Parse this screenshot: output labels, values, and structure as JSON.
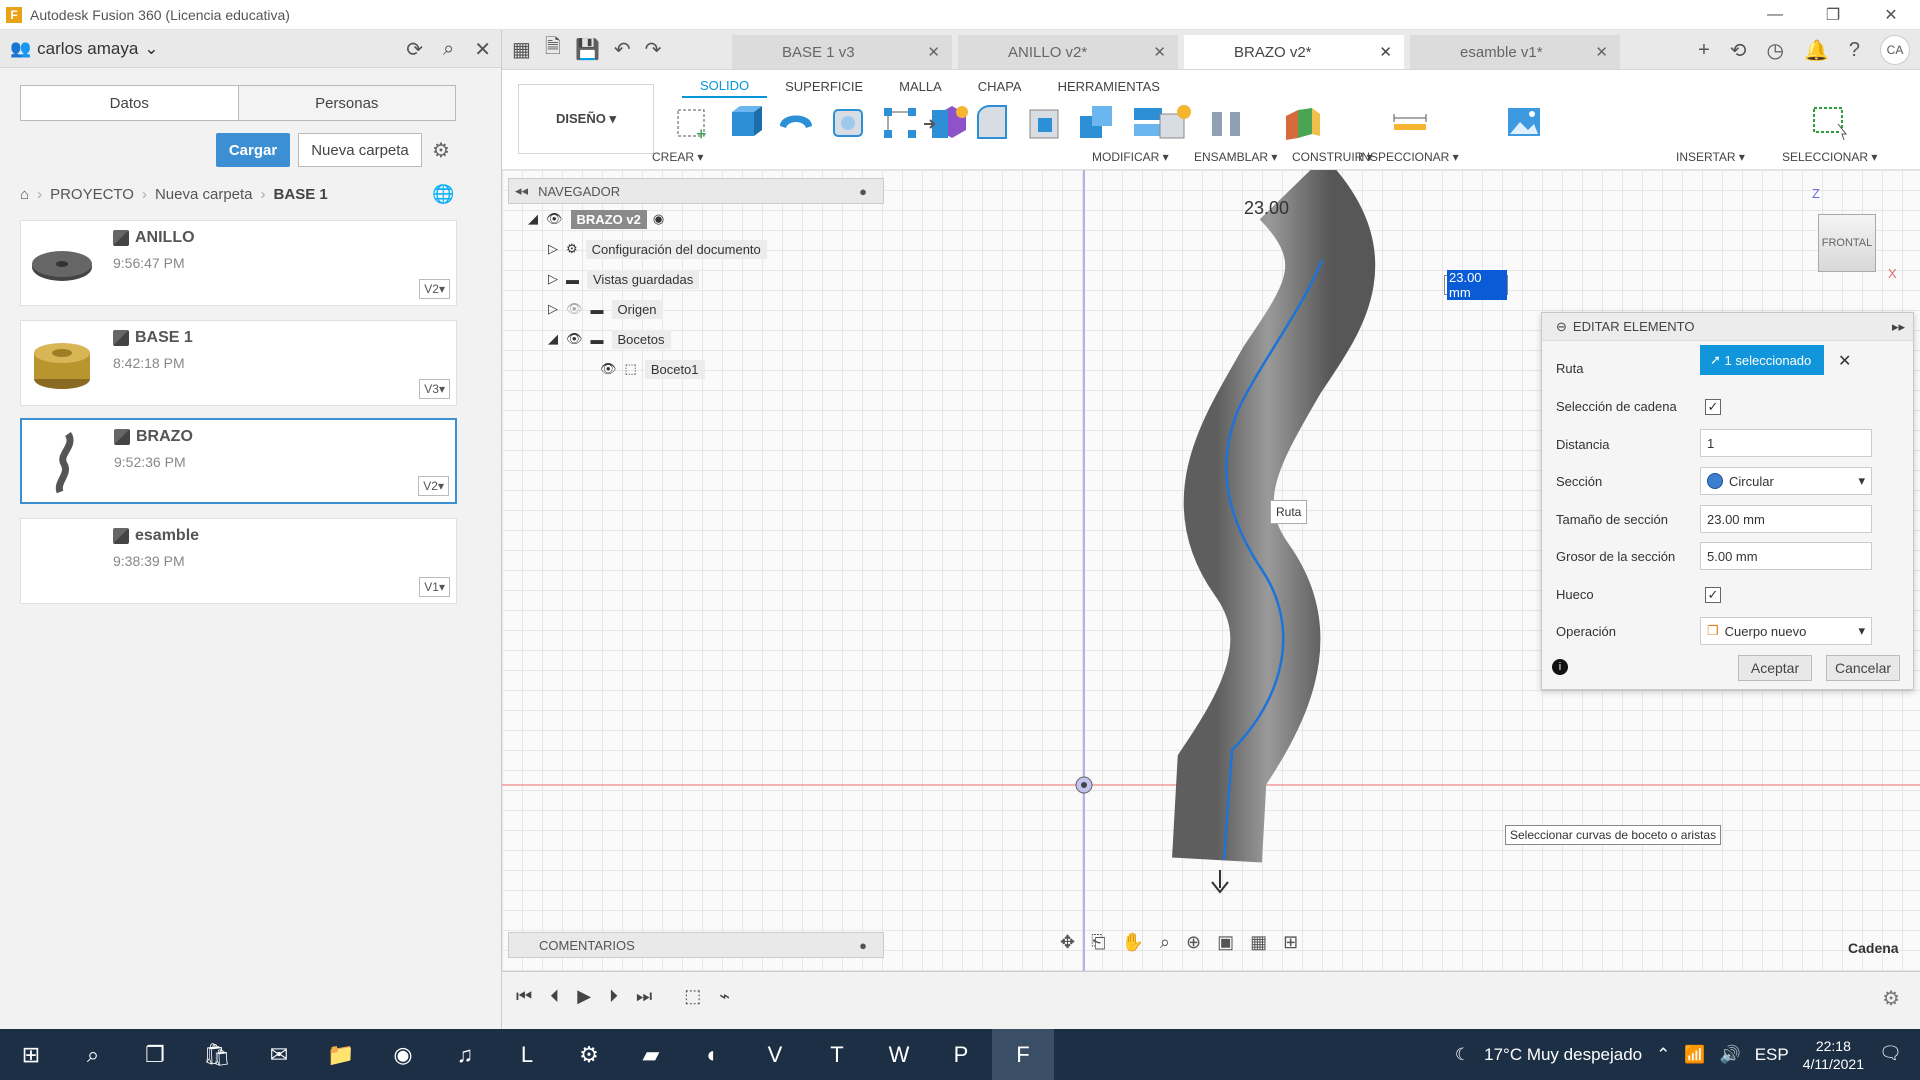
{
  "window": {
    "title": "Autodesk Fusion 360 (Licencia educativa)"
  },
  "data_panel": {
    "user": "carlos amaya",
    "tabs": [
      "Datos",
      "Personas"
    ],
    "upload_label": "Cargar",
    "new_folder_label": "Nueva carpeta",
    "breadcrumb": [
      "PROYECTO",
      "Nueva carpeta",
      "BASE 1"
    ],
    "files": [
      {
        "name": "ANILLO",
        "time": "9:56:47 PM",
        "version": "V2▾"
      },
      {
        "name": "BASE 1",
        "time": "8:42:18 PM",
        "version": "V3▾"
      },
      {
        "name": "BRAZO",
        "time": "9:52:36 PM",
        "version": "V2▾"
      },
      {
        "name": "esamble",
        "time": "9:38:39 PM",
        "version": "V1▾"
      }
    ]
  },
  "doc_tabs": [
    {
      "label": "BASE 1 v3"
    },
    {
      "label": "ANILLO v2*"
    },
    {
      "label": "BRAZO v2*"
    },
    {
      "label": "esamble v1*"
    }
  ],
  "user_initials": "CA",
  "ribbon": {
    "workspace": "DISEÑO ▾",
    "tabs": [
      "SOLIDO",
      "SUPERFICIE",
      "MALLA",
      "CHAPA",
      "HERRAMIENTAS"
    ],
    "groups": [
      "CREAR ▾",
      "MODIFICAR ▾",
      "ENSAMBLAR ▾",
      "CONSTRUIR ▾",
      "INSPECCIONAR ▾",
      "INSERTAR ▾",
      "SELECCIONAR ▾"
    ]
  },
  "navigator": {
    "title": "NAVEGADOR",
    "root": "BRAZO v2",
    "items": [
      "Configuración del documento",
      "Vistas guardadas",
      "Origen",
      "Bocetos",
      "Boceto1"
    ]
  },
  "comments": {
    "title": "COMENTARIOS"
  },
  "viewport": {
    "dimension_label": "23.00",
    "dimension_input": "23.00 mm",
    "ruta_tip": "Ruta",
    "tooltip": "Seleccionar curvas de boceto o aristas",
    "viewcube_label": "FRONTAL",
    "axis_z": "Z",
    "axis_x": "X",
    "status": "Cadena"
  },
  "dialog": {
    "title": "EDITAR ELEMENTO",
    "ruta_label": "Ruta",
    "ruta_value": "1 seleccionado",
    "chain_label": "Selección de cadena",
    "chain_checked": "✓",
    "distance_label": "Distancia",
    "distance_value": "1",
    "section_label": "Sección",
    "section_value": "Circular",
    "section_size_label": "Tamaño de sección",
    "section_size_value": "23.00 mm",
    "thickness_label": "Grosor de la sección",
    "thickness_value": "5.00 mm",
    "hollow_label": "Hueco",
    "hollow_checked": "✓",
    "operation_label": "Operación",
    "operation_value": "Cuerpo nuevo",
    "ok_label": "Aceptar",
    "cancel_label": "Cancelar"
  },
  "taskbar": {
    "weather": "17°C  Muy despejado",
    "lang": "ESP",
    "time": "22:18",
    "date": "4/11/2021"
  }
}
